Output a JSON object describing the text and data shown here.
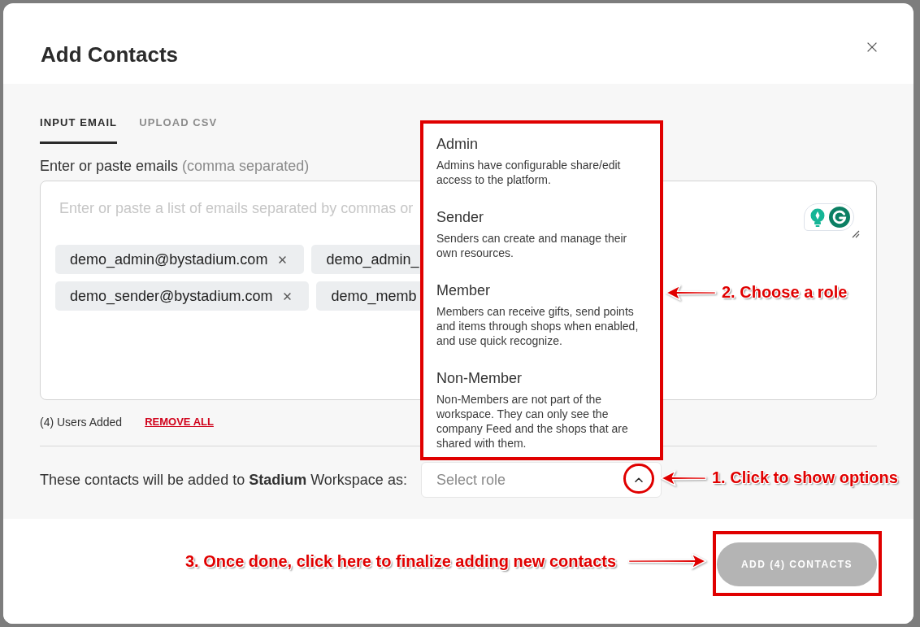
{
  "dialog": {
    "title": "Add Contacts"
  },
  "tabs": [
    {
      "label": "INPUT EMAIL",
      "selected": true
    },
    {
      "label": "UPLOAD CSV",
      "selected": false
    }
  ],
  "email_input": {
    "label": "Enter or paste emails",
    "label_hint": "(comma separated)",
    "placeholder": "Enter or paste a list of emails separated by commas or",
    "chips": [
      {
        "email": "demo_admin@bystadium.com",
        "remove_icon": true
      },
      {
        "email": "demo_admin_",
        "remove_icon": false
      },
      {
        "email": "demo_sender@bystadium.com",
        "remove_icon": true
      },
      {
        "email": "demo_memb",
        "remove_icon": false
      }
    ]
  },
  "summary": {
    "users_added": "(4) Users Added",
    "remove_all": "REMOVE ALL"
  },
  "role": {
    "prompt": "These contacts will be added to **Stadium** Workspace as:",
    "select": {
      "placeholder": "Select role",
      "expanded": true
    },
    "options": [
      {
        "title": "Admin",
        "description": "Admins have configurable share/edit access to the platform."
      },
      {
        "title": "Sender",
        "description": "Senders can create and manage their own resources."
      },
      {
        "title": "Member",
        "description": "Members can receive gifts, send points and items through shops when enabled, and use quick recognize."
      },
      {
        "title": "Non-Member",
        "description": "Non-Members are not part of the workspace. They can only see the company Feed and the shops that are shared with them."
      }
    ]
  },
  "footer": {
    "submit": {
      "label": "ADD (4) CONTACTS",
      "disabled": true
    }
  },
  "annotations": [
    {
      "text": "2. Choose a role"
    },
    {
      "text": "1. Click to show options"
    },
    {
      "text": "3. Once done, click here to finalize adding new contacts"
    }
  ]
}
